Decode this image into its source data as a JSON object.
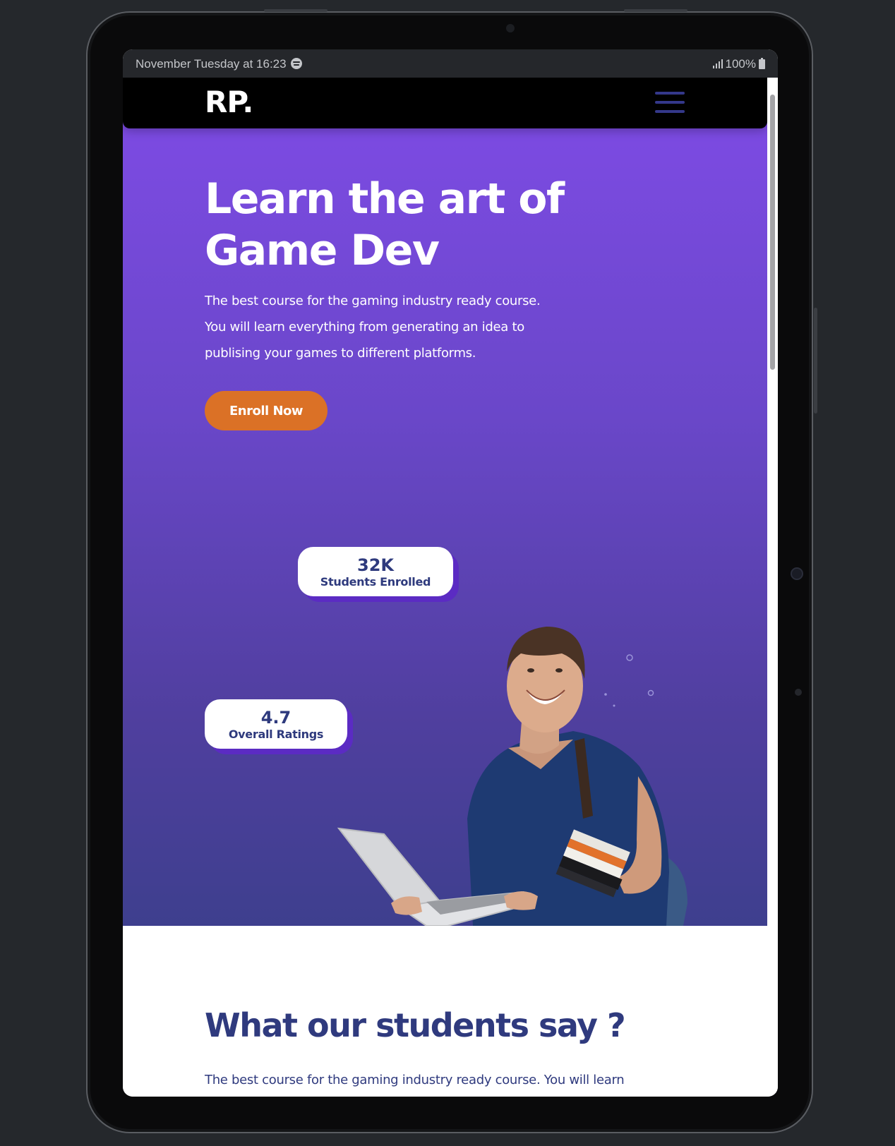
{
  "statusbar": {
    "time_text": "November Tuesday at 16:23",
    "battery_text": "100%"
  },
  "navbar": {
    "logo": "RP."
  },
  "hero": {
    "title_line1": "Learn the art of",
    "title_line2": "Game Dev",
    "desc_line1": "The best course for the gaming industry ready course.",
    "desc_line2": "You will learn everything from generating an idea to",
    "desc_line3": "publising your games to different platforms.",
    "cta_label": "Enroll Now"
  },
  "stats": {
    "students_value": "32K",
    "students_label": "Students Enrolled",
    "ratings_value": "4.7",
    "ratings_label": "Overall Ratings"
  },
  "testimonials": {
    "title": "What our students say ?",
    "desc": "The best course for the gaming industry ready course. You will learn"
  },
  "colors": {
    "hero_top": "#7f4be6",
    "hero_bottom": "#3e3f8e",
    "cta": "#db7126",
    "heading_navy": "#2f3a7e",
    "card_shadow": "#5b2bc3"
  }
}
